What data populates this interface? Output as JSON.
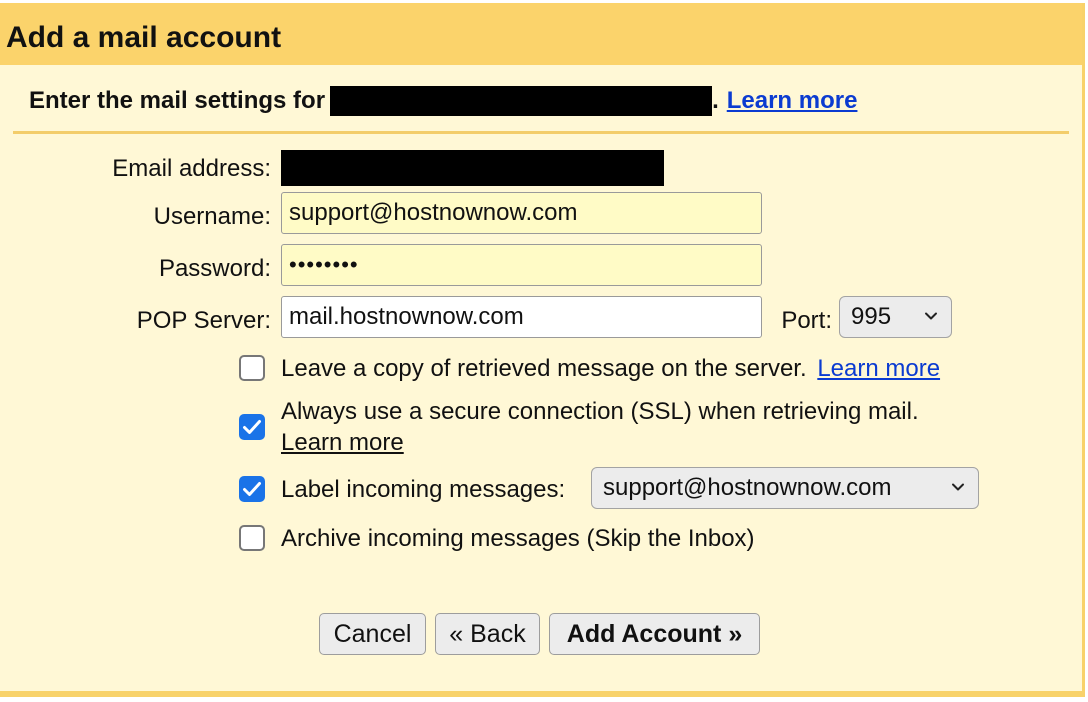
{
  "dialog": {
    "title": "Add a mail account",
    "subtitle_prefix": "Enter the mail settings for",
    "subtitle_suffix": ".",
    "learn_more": "Learn more"
  },
  "form": {
    "email_label": "Email address:",
    "username_label": "Username:",
    "username_value": "support@hostnownow.com",
    "password_label": "Password:",
    "password_value": "••••••••",
    "pop_label": "POP Server:",
    "pop_value": "mail.hostnownow.com",
    "port_label": "Port:",
    "port_value": "995"
  },
  "options": {
    "leave_copy": {
      "text": "Leave a copy of retrieved message on the server.",
      "link": "Learn more",
      "checked": false
    },
    "ssl": {
      "text": "Always use a secure connection (SSL) when retrieving mail.",
      "link": "Learn more",
      "checked": true
    },
    "label_incoming": {
      "text": "Label incoming messages:",
      "value": "support@hostnownow.com",
      "checked": true
    },
    "archive": {
      "text": "Archive incoming messages (Skip the Inbox)",
      "checked": false
    }
  },
  "buttons": {
    "cancel": "Cancel",
    "back": "« Back",
    "add": "Add Account »"
  },
  "colors": {
    "header": "#fbd36b",
    "panel": "#fff8d6",
    "link": "#0b3bd1",
    "checkbox_on": "#1a73e8",
    "autofill": "#fffbc6"
  }
}
